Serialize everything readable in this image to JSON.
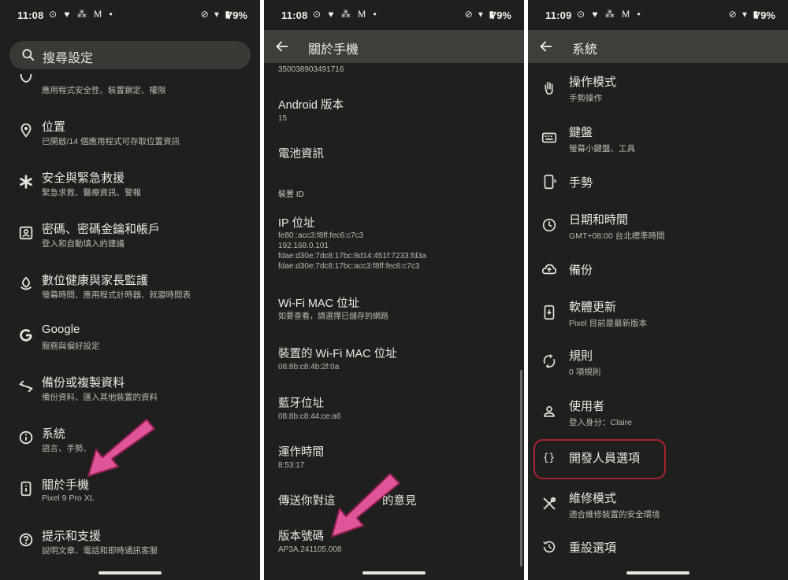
{
  "status_bars": [
    {
      "time": "11:08",
      "notifications": "⊙ ♥ ⁂ M •",
      "system": "⊘ ▾ ▮",
      "battery": "79%"
    },
    {
      "time": "11:08",
      "notifications": "⊙ ♥ ⁂ M •",
      "system": "⊘ ▾ ▮",
      "battery": "79%"
    },
    {
      "time": "11:09",
      "notifications": "⊙ ♥ ⁂ M •",
      "system": "⊘ ▾ ▮",
      "battery": "79%"
    }
  ],
  "settings": {
    "search_placeholder": "搜尋設定",
    "items": [
      {
        "title": "",
        "subtitle": "應用程式安全性、裝置鎖定、權限",
        "icon": "shield-icon"
      },
      {
        "title": "位置",
        "subtitle": "已開啟/14 個應用程式可存取位置資訊",
        "icon": "location-pin-icon"
      },
      {
        "title": "安全與緊急救援",
        "subtitle": "緊急求救、醫療資訊、警報",
        "icon": "asterisk-icon"
      },
      {
        "title": "密碼、密碼金鑰和帳戶",
        "subtitle": "登入和自動填入的建議",
        "icon": "account-box-icon"
      },
      {
        "title": "數位健康與家長監護",
        "subtitle": "螢幕時間、應用程式計時器、就寢時間表",
        "icon": "wellbeing-icon"
      },
      {
        "title": "Google",
        "subtitle": "服務與偏好設定",
        "icon": "google-g-icon"
      },
      {
        "title": "備份或複製資料",
        "subtitle": "備份資料、匯入其他裝置的資料",
        "icon": "transfer-icon"
      },
      {
        "title": "系統",
        "subtitle": "語言、手勢、",
        "icon": "info-icon"
      },
      {
        "title": "關於手機",
        "subtitle": "Pixel 9 Pro XL",
        "icon": "phone-info-icon"
      },
      {
        "title": "提示和支援",
        "subtitle": "說明文章、電話和即時通訊客服",
        "icon": "help-icon"
      }
    ]
  },
  "about": {
    "title": "關於手機",
    "top_value": "350038903491716",
    "android_version_label": "Android 版本",
    "android_version_value": "15",
    "battery_info_label": "電池資訊",
    "device_id_section": "裝置 ID",
    "ip_label": "IP 位址",
    "ip_values": [
      "fe80::acc3:f8ff:fec6:c7c3",
      "192.168.0.101",
      "fdae:d30e:7dc8:17bc:8d14:451f:7233:fd3a",
      "fdae:d30e:7dc8:17bc:acc3:f8ff:fec6:c7c3"
    ],
    "wifi_mac_label": "Wi-Fi MAC 位址",
    "wifi_mac_value": "如要查看，請選擇已儲存的網路",
    "device_wifi_mac_label": "裝置的 Wi-Fi MAC 位址",
    "device_wifi_mac_value": "08:8b:c8:4b:2f:0a",
    "bt_label": "藍牙位址",
    "bt_value": "08:8b:c8:44:ce:a6",
    "uptime_label": "運作時間",
    "uptime_value": "8:53:17",
    "feedback_label": "傳送你對這",
    "feedback_label_end": "的意見",
    "build_label": "版本號碼",
    "build_value": "AP3A.241105.008"
  },
  "system": {
    "title": "系統",
    "items": [
      {
        "title": "操作模式",
        "subtitle": "手勢操作",
        "icon": "gesture-hand-icon"
      },
      {
        "title": "鍵盤",
        "subtitle": "螢幕小鍵盤、工具",
        "icon": "keyboard-icon"
      },
      {
        "title": "手勢",
        "subtitle": "",
        "icon": "phone-gesture-icon"
      },
      {
        "title": "日期和時間",
        "subtitle": "GMT+08:00 台北標準時間",
        "icon": "clock-icon"
      },
      {
        "title": "備份",
        "subtitle": "",
        "icon": "cloud-upload-icon"
      },
      {
        "title": "軟體更新",
        "subtitle": "Pixel 目前是最新版本",
        "icon": "system-update-icon"
      },
      {
        "title": "規則",
        "subtitle": "0 項規則",
        "icon": "rules-icon"
      },
      {
        "title": "使用者",
        "subtitle": "登入身分：Claire",
        "icon": "person-icon"
      },
      {
        "title": "開發人員選項",
        "subtitle": "",
        "icon": "braces-icon"
      },
      {
        "title": "維修模式",
        "subtitle": "適合維修裝置的安全環境",
        "icon": "repair-tools-icon"
      },
      {
        "title": "重設選項",
        "subtitle": "",
        "icon": "history-icon"
      }
    ]
  },
  "colors": {
    "background": "#1f1f1d",
    "appbar": "#3f3e3a",
    "arrow": "#e0559a",
    "highlight": "#a8232f"
  }
}
